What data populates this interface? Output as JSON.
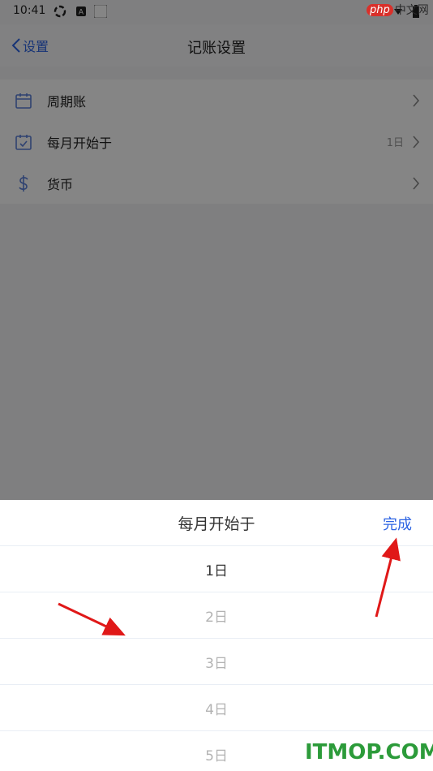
{
  "status_bar": {
    "time": "10:41"
  },
  "nav": {
    "back_label": "设置",
    "title": "记账设置"
  },
  "settings_list": [
    {
      "icon": "calendar-icon",
      "label": "周期账",
      "value": ""
    },
    {
      "icon": "calendar-check-icon",
      "label": "每月开始于",
      "value": "1日"
    },
    {
      "icon": "dollar-icon",
      "label": "货币",
      "value": ""
    }
  ],
  "picker": {
    "title": "每月开始于",
    "done_label": "完成",
    "selected_index": 0,
    "options": [
      "1日",
      "2日",
      "3日",
      "4日",
      "5日"
    ]
  },
  "watermarks": {
    "top_badge": "php",
    "top_text": "中文网",
    "bottom": "ITMOP.COM"
  },
  "colors": {
    "accent": "#2d64e3",
    "icon": "#5b7fd8",
    "arrow": "#e01818",
    "watermark_green": "#2c9b3a"
  }
}
